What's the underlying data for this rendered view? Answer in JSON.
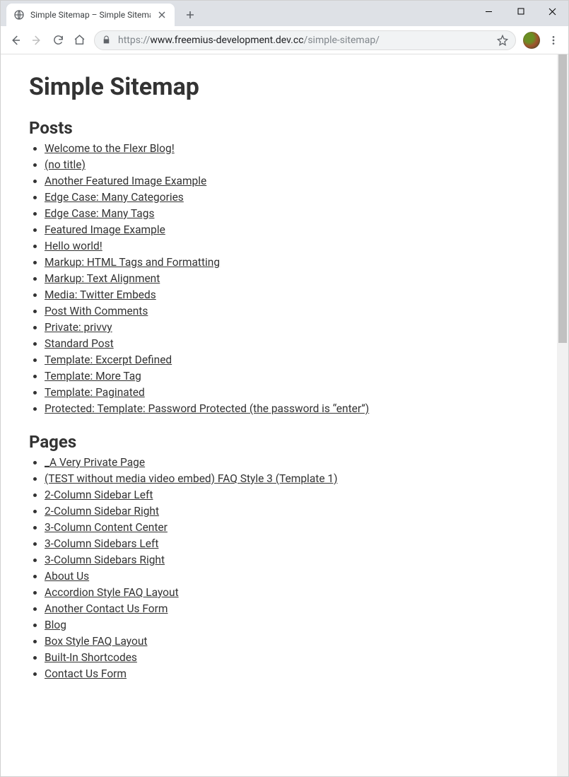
{
  "window": {
    "tab_title": "Simple Sitemap – Simple Sitemap"
  },
  "toolbar": {
    "url_prefix": "https://",
    "url_host": "www.freemius-development.dev.cc",
    "url_path": "/simple-sitemap/"
  },
  "page": {
    "title": "Simple Sitemap",
    "sections": [
      {
        "heading": "Posts",
        "items": [
          "Welcome to the Flexr Blog!",
          "(no title)",
          "Another Featured Image Example",
          "Edge Case: Many Categories",
          "Edge Case: Many Tags",
          "Featured Image Example",
          "Hello world!",
          "Markup: HTML Tags and Formatting",
          "Markup: Text Alignment",
          "Media: Twitter Embeds",
          "Post With Comments",
          "Private: privvy",
          "Standard Post",
          "Template: Excerpt Defined",
          "Template: More Tag",
          "Template: Paginated",
          "Protected: Template: Password Protected (the password is “enter”)"
        ]
      },
      {
        "heading": "Pages",
        "items": [
          "_A Very Private Page",
          "(TEST without media video embed) FAQ Style 3 (Template 1)",
          "2-Column Sidebar Left",
          "2-Column Sidebar Right",
          "3-Column Content Center",
          "3-Column Sidebars Left",
          "3-Column Sidebars Right",
          "About Us",
          "Accordion Style FAQ Layout",
          "Another Contact Us Form",
          "Blog",
          "Box Style FAQ Layout",
          "Built-In Shortcodes",
          "Contact Us Form"
        ]
      }
    ]
  }
}
